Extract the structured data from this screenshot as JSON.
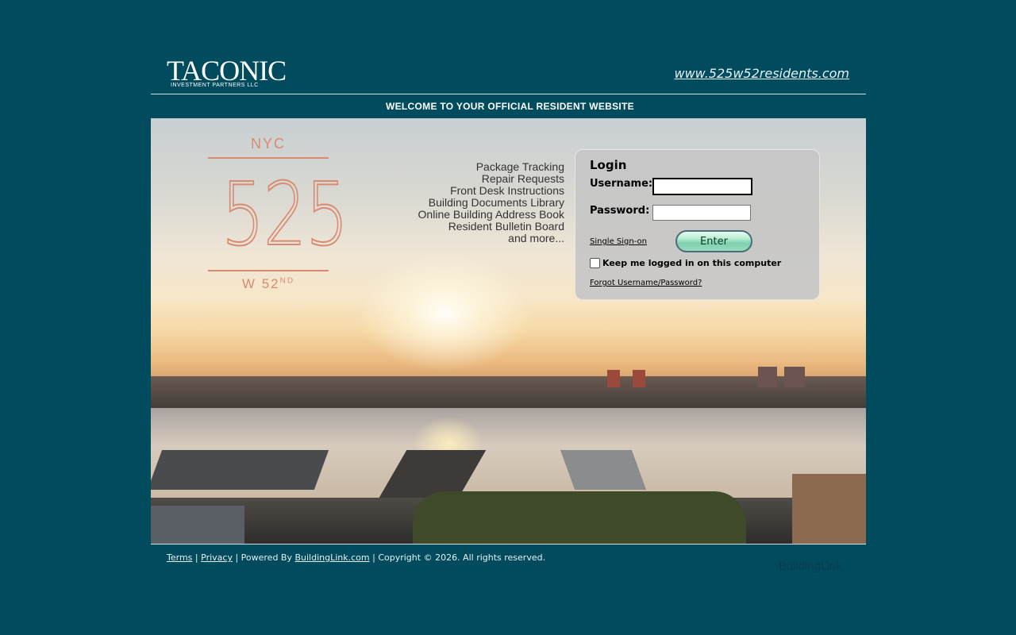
{
  "header": {
    "brand_main": "TACONIC",
    "brand_sub": "INVESTMENT PARTNERS LLC",
    "site_link": "www.525w52residents.com",
    "welcome": "WELCOME TO YOUR OFFICIAL RESIDENT WEBSITE"
  },
  "building_logo": {
    "city": "NYC",
    "number": "525",
    "street": "W 52",
    "street_suffix": "ND"
  },
  "features": [
    "Package Tracking",
    "Repair Requests",
    "Front Desk Instructions",
    "Building Documents Library",
    "Online Building Address Book",
    "Resident Bulletin Board",
    "and more..."
  ],
  "login": {
    "title": "Login",
    "username_label": "Username:",
    "username_value": "",
    "password_label": "Password:",
    "password_value": "",
    "sso_link": "Single Sign-on",
    "enter_button": "Enter",
    "keep_logged_in": "Keep me logged in on this computer",
    "keep_logged_in_checked": false,
    "forgot_link": "Forgot Username/Password?"
  },
  "footer": {
    "terms": "Terms",
    "sep1": "|",
    "privacy": "Privacy",
    "powered_by": "| Powered By",
    "buildinglink": "BuildingLink.com",
    "copyright": "| Copyright © 2026. All rights reserved.",
    "brand": "BuildingLink"
  },
  "colors": {
    "page_bg": "#004c5e",
    "building_logo": "#d98b72",
    "login_panel": "#c6c6c6"
  }
}
